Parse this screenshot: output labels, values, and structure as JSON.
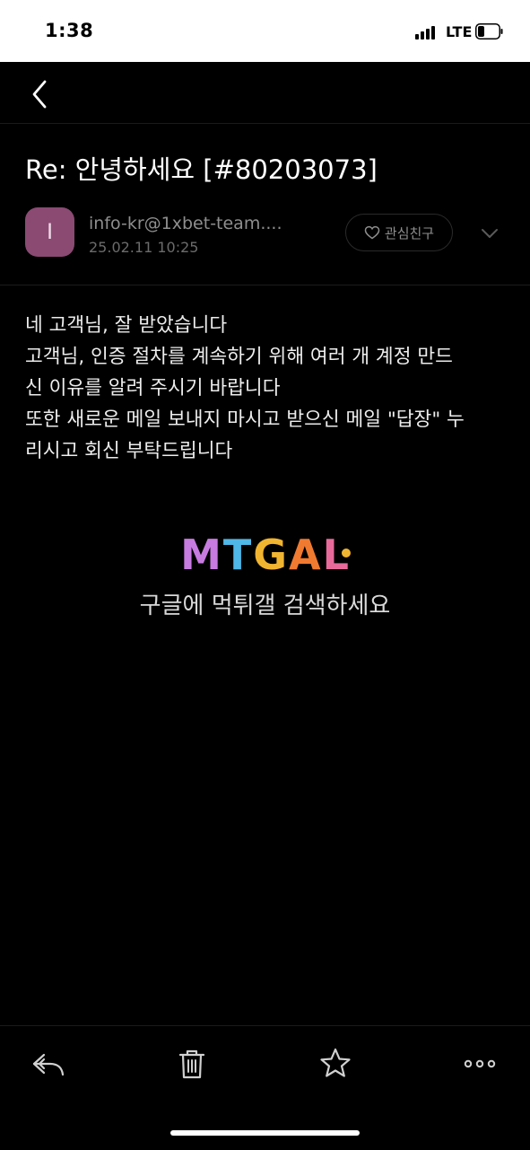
{
  "status_bar": {
    "time": "1:38",
    "network": "LTE"
  },
  "nav": {
    "back_icon": "chevron-left-icon"
  },
  "email": {
    "subject": "Re: 안녕하세요 [#80203073]",
    "sender": {
      "avatar_letter": "I",
      "avatar_color": "#8a4a72",
      "address": "info-kr@1xbet-team....",
      "date": "25.02.11 10:25"
    },
    "favorite_label": "관심친구",
    "body_lines": [
      "네 고객님, 잘 받았습니다",
      "고객님, 인증 절차를 계속하기 위해 여러 개 계정 만드",
      "신 이유를 알려 주시기 바랍니다",
      "또한 새로운 메일 보내지 마시고 받으신 메일 \"답장\" 누",
      "리시고 회신 부탁드립니다"
    ]
  },
  "watermark": {
    "logo_text": "MTGAL",
    "caption": "구글에 먹튀갤 검색하세요"
  },
  "toolbar": {
    "icons": [
      "reply-icon",
      "trash-icon",
      "star-icon",
      "more-icon"
    ]
  }
}
